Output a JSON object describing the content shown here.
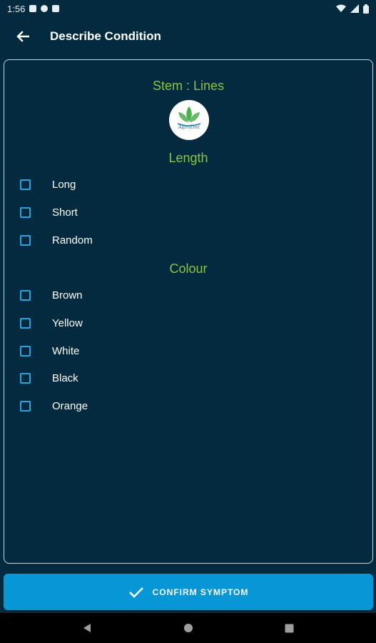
{
  "status_bar": {
    "time": "1:56",
    "icons": [
      "notification-icon",
      "data-saver-icon",
      "sd-card-icon",
      "wifi-icon",
      "signal-icon",
      "battery-icon"
    ]
  },
  "app_bar": {
    "title": "Describe Condition",
    "back_icon": "arrow-left-icon"
  },
  "card": {
    "title": "Stem : Lines",
    "logo_text": "AgroDoc",
    "sections": [
      {
        "heading": "Length",
        "options": [
          {
            "label": "Long",
            "checked": false
          },
          {
            "label": "Short",
            "checked": false
          },
          {
            "label": "Random",
            "checked": false
          }
        ]
      },
      {
        "heading": "Colour",
        "options": [
          {
            "label": "Brown",
            "checked": false
          },
          {
            "label": "Yellow",
            "checked": false
          },
          {
            "label": "White",
            "checked": false
          },
          {
            "label": "Black",
            "checked": false
          },
          {
            "label": "Orange",
            "checked": false
          }
        ]
      }
    ]
  },
  "confirm_button": {
    "label": "CONFIRM SYMPTOM",
    "icon": "check-icon"
  },
  "nav_bar": {
    "buttons": [
      "back-triangle-icon",
      "home-circle-icon",
      "recents-square-icon"
    ]
  },
  "colors": {
    "background": "#032a3e",
    "accent_green": "#8bc34a",
    "checkbox_blue": "#29a3e0",
    "button_blue": "#0897d6"
  }
}
